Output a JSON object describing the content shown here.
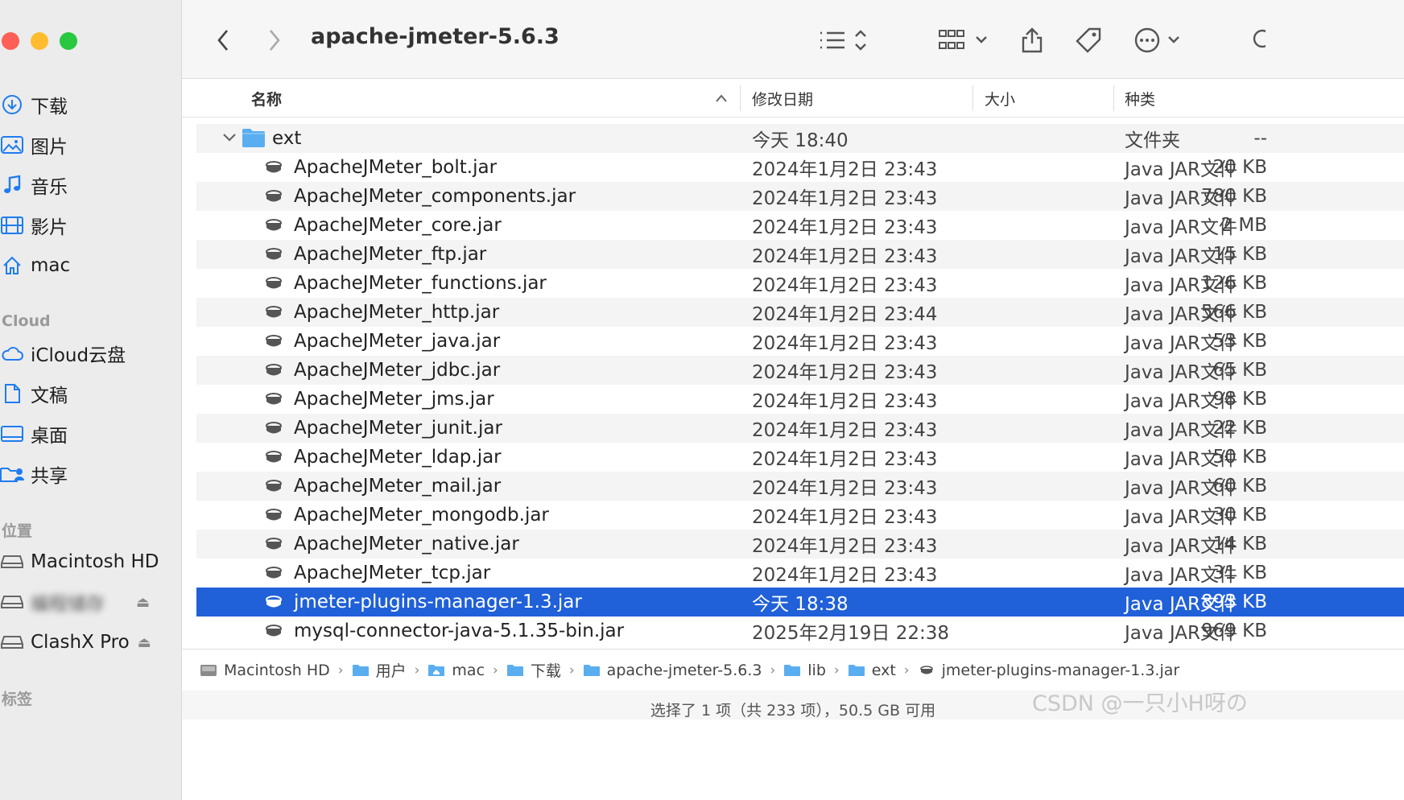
{
  "window": {
    "title": "apache-jmeter-5.6.3"
  },
  "sidebar": {
    "favorites": [
      {
        "label": "下载",
        "icon": "download-icon"
      },
      {
        "label": "图片",
        "icon": "photos-icon"
      },
      {
        "label": "音乐",
        "icon": "music-icon"
      },
      {
        "label": "影片",
        "icon": "movies-icon"
      },
      {
        "label": "mac",
        "icon": "home-icon"
      }
    ],
    "cloud_title": "Cloud",
    "cloud": [
      {
        "label": "iCloud云盘",
        "icon": "cloud-icon"
      },
      {
        "label": "文稿",
        "icon": "document-icon"
      },
      {
        "label": "桌面",
        "icon": "desktop-icon"
      },
      {
        "label": "共享",
        "icon": "shared-folder-icon"
      }
    ],
    "locations_title": "位置",
    "locations": [
      {
        "label": "Macintosh HD",
        "icon": "disk-icon"
      },
      {
        "label": "编程储存",
        "icon": "disk-icon"
      },
      {
        "label": "ClashX Pro",
        "icon": "disk-icon"
      }
    ],
    "tags_title": "标签"
  },
  "columns": {
    "name": "名称",
    "date": "修改日期",
    "size": "大小",
    "kind": "种类"
  },
  "folder_row": {
    "name": "ext",
    "date": "今天 18:40",
    "size": "--",
    "kind": "文件夹"
  },
  "files": [
    {
      "name": "ApacheJMeter_bolt.jar",
      "date": "2024年1月2日 23:43",
      "size": "20 KB",
      "kind": "Java JAR文件"
    },
    {
      "name": "ApacheJMeter_components.jar",
      "date": "2024年1月2日 23:43",
      "size": "780 KB",
      "kind": "Java JAR文件"
    },
    {
      "name": "ApacheJMeter_core.jar",
      "date": "2024年1月2日 23:43",
      "size": "2 MB",
      "kind": "Java JAR文件"
    },
    {
      "name": "ApacheJMeter_ftp.jar",
      "date": "2024年1月2日 23:43",
      "size": "15 KB",
      "kind": "Java JAR文件"
    },
    {
      "name": "ApacheJMeter_functions.jar",
      "date": "2024年1月2日 23:43",
      "size": "126 KB",
      "kind": "Java JAR文件"
    },
    {
      "name": "ApacheJMeter_http.jar",
      "date": "2024年1月2日 23:44",
      "size": "566 KB",
      "kind": "Java JAR文件"
    },
    {
      "name": "ApacheJMeter_java.jar",
      "date": "2024年1月2日 23:43",
      "size": "53 KB",
      "kind": "Java JAR文件"
    },
    {
      "name": "ApacheJMeter_jdbc.jar",
      "date": "2024年1月2日 23:43",
      "size": "65 KB",
      "kind": "Java JAR文件"
    },
    {
      "name": "ApacheJMeter_jms.jar",
      "date": "2024年1月2日 23:43",
      "size": "98 KB",
      "kind": "Java JAR文件"
    },
    {
      "name": "ApacheJMeter_junit.jar",
      "date": "2024年1月2日 23:43",
      "size": "22 KB",
      "kind": "Java JAR文件"
    },
    {
      "name": "ApacheJMeter_ldap.jar",
      "date": "2024年1月2日 23:43",
      "size": "50 KB",
      "kind": "Java JAR文件"
    },
    {
      "name": "ApacheJMeter_mail.jar",
      "date": "2024年1月2日 23:43",
      "size": "60 KB",
      "kind": "Java JAR文件"
    },
    {
      "name": "ApacheJMeter_mongodb.jar",
      "date": "2024年1月2日 23:43",
      "size": "30 KB",
      "kind": "Java JAR文件"
    },
    {
      "name": "ApacheJMeter_native.jar",
      "date": "2024年1月2日 23:43",
      "size": "14 KB",
      "kind": "Java JAR文件"
    },
    {
      "name": "ApacheJMeter_tcp.jar",
      "date": "2024年1月2日 23:43",
      "size": "31 KB",
      "kind": "Java JAR文件"
    },
    {
      "name": "jmeter-plugins-manager-1.3.jar",
      "date": "今天 18:38",
      "size": "893 KB",
      "kind": "Java JAR文件",
      "selected": true
    },
    {
      "name": "mysql-connector-java-5.1.35-bin.jar",
      "date": "2025年2月19日 22:38",
      "size": "969 KB",
      "kind": "Java JAR文件"
    }
  ],
  "pathbar": [
    {
      "label": "Macintosh HD",
      "icon": "disk-icon"
    },
    {
      "label": "用户",
      "icon": "folder-icon"
    },
    {
      "label": "mac",
      "icon": "home-folder-icon"
    },
    {
      "label": "下载",
      "icon": "folder-icon"
    },
    {
      "label": "apache-jmeter-5.6.3",
      "icon": "folder-icon"
    },
    {
      "label": "lib",
      "icon": "folder-icon"
    },
    {
      "label": "ext",
      "icon": "folder-icon"
    },
    {
      "label": "jmeter-plugins-manager-1.3.jar",
      "icon": "jar-icon"
    }
  ],
  "status": "选择了 1 项（共 233 项），50.5 GB 可用",
  "watermark": "CSDN @一只小H呀の",
  "colors": {
    "selection": "#2060d8",
    "folder": "#5aaef0",
    "accent": "#1f7cf0"
  }
}
